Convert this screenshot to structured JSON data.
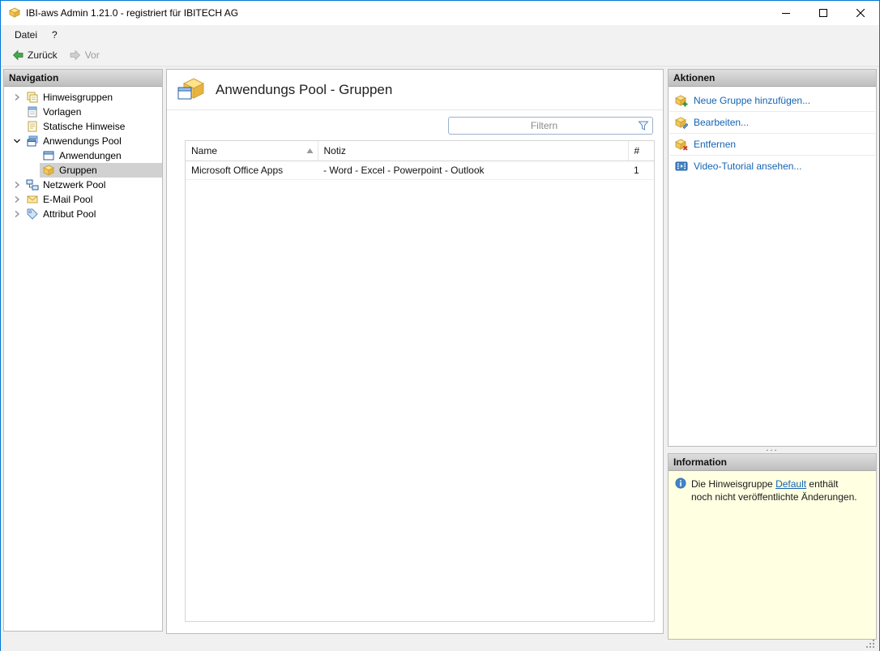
{
  "window": {
    "title": "IBI-aws Admin 1.21.0 - registriert für IBITECH AG"
  },
  "menu": {
    "items": [
      {
        "label": "Datei"
      },
      {
        "label": "?"
      }
    ]
  },
  "toolbar": {
    "back_label": "Zurück",
    "forward_label": "Vor"
  },
  "navigation": {
    "header": "Navigation",
    "items": [
      {
        "label": "Hinweisgruppen",
        "level": 0,
        "state": "collapsed",
        "selected": false
      },
      {
        "label": "Vorlagen",
        "level": 0,
        "state": "leaf",
        "selected": false
      },
      {
        "label": "Statische Hinweise",
        "level": 0,
        "state": "leaf",
        "selected": false
      },
      {
        "label": "Anwendungs Pool",
        "level": 0,
        "state": "expanded",
        "selected": false
      },
      {
        "label": "Anwendungen",
        "level": 1,
        "state": "leaf",
        "selected": false
      },
      {
        "label": "Gruppen",
        "level": 1,
        "state": "leaf",
        "selected": true
      },
      {
        "label": "Netzwerk Pool",
        "level": 0,
        "state": "collapsed",
        "selected": false
      },
      {
        "label": "E-Mail Pool",
        "level": 0,
        "state": "collapsed",
        "selected": false
      },
      {
        "label": "Attribut Pool",
        "level": 0,
        "state": "collapsed",
        "selected": false
      }
    ]
  },
  "main": {
    "title": "Anwendungs Pool - Gruppen",
    "filter_placeholder": "Filtern",
    "table": {
      "columns": [
        "Name",
        "Notiz",
        "#"
      ],
      "sort": {
        "column": "Name",
        "direction": "ascending"
      },
      "rows": [
        {
          "name": "Microsoft Office Apps",
          "notiz": "- Word - Excel - Powerpoint - Outlook",
          "count": "1"
        }
      ]
    }
  },
  "actions": {
    "header": "Aktionen",
    "items": [
      {
        "label": "Neue Gruppe hinzufügen..."
      },
      {
        "label": "Bearbeiten..."
      },
      {
        "label": "Entfernen"
      },
      {
        "label": "Video-Tutorial ansehen..."
      }
    ]
  },
  "information": {
    "header": "Information",
    "text_before": "Die Hinweisgruppe ",
    "link_label": "Default",
    "text_after": " enthält noch nicht veröffentlichte Änderungen."
  },
  "colors": {
    "window_border": "#0078d7",
    "link": "#1464b4",
    "info_background": "#ffffe1",
    "selection": "#d1d1d1",
    "panel_header_top": "#dedede",
    "panel_header_bottom": "#bfbfbf"
  }
}
